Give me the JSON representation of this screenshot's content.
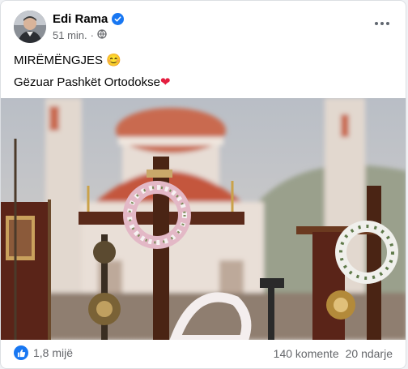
{
  "post": {
    "author": "Edi Rama",
    "time": "51 min.",
    "visibility_icon": "globe-icon",
    "verified_icon": "verified-badge-icon",
    "text_line1": "MIRËMËNGJES",
    "text_line1_emoji": "😊",
    "text_line2": "Gëzuar Pashkët Ortodokse",
    "text_line2_emoji": "❤"
  },
  "reactions": {
    "icon": "like-icon",
    "count": "1,8 mijë",
    "comments": "140 komente",
    "shares": "20 ndarje"
  },
  "colors": {
    "accent": "#1877f2",
    "text": "#050505",
    "muted": "#65676b",
    "heart": "#e41e3f"
  }
}
